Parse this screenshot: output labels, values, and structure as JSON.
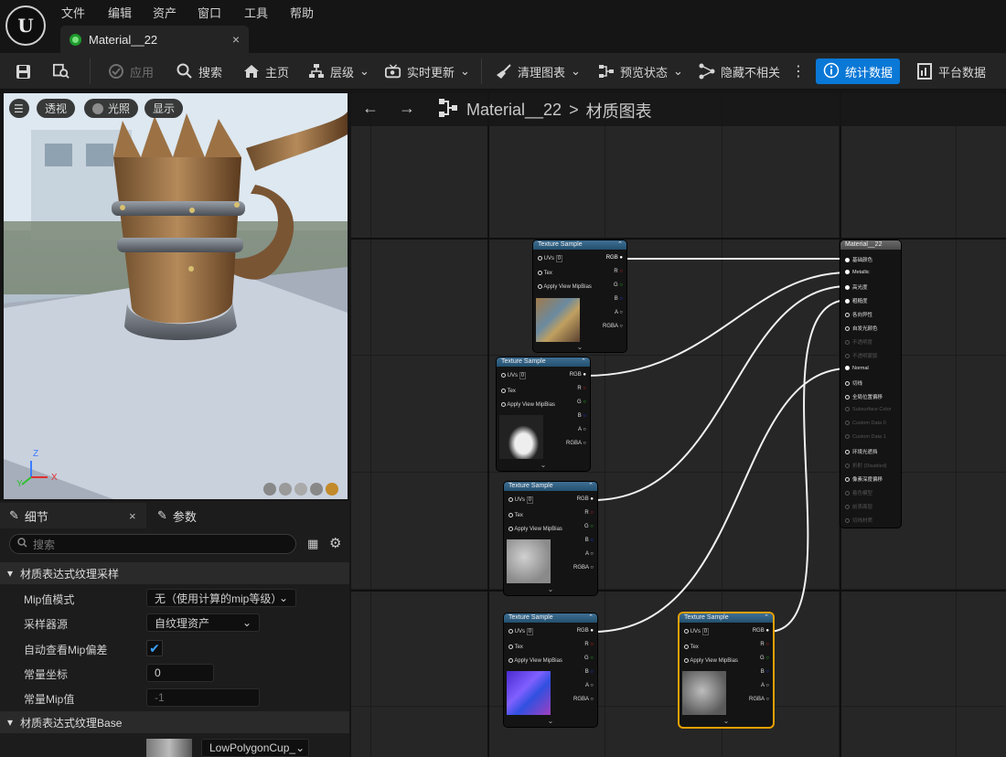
{
  "menu": [
    "文件",
    "编辑",
    "资产",
    "窗口",
    "工具",
    "帮助"
  ],
  "tab": {
    "title": "Material__22",
    "close": "×"
  },
  "toolbar": {
    "apply": "应用",
    "search": "搜索",
    "home": "主页",
    "hierarchy": "层级",
    "live_update": "实时更新",
    "clean_graph": "清理图表",
    "preview_state": "预览状态",
    "hide_unrelated": "隐藏不相关",
    "stats": "统计数据",
    "platform_stats": "平台数据",
    "more": "⋮"
  },
  "viewport": {
    "perspective": "透视",
    "lit": "光照",
    "show": "显示",
    "axis_x": "X",
    "axis_y": "Y",
    "axis_z": "Z"
  },
  "details": {
    "tab_details": "细节",
    "tab_params": "参数",
    "close": "×",
    "search_placeholder": "搜索",
    "section1": "材质表达式纹理采样",
    "rows": [
      {
        "label": "Mip值模式",
        "value": "无（使用计算的mip等级）"
      },
      {
        "label": "采样器源",
        "value": "自纹理资产"
      },
      {
        "label": "自动查看Mip偏差",
        "value": "✔"
      },
      {
        "label": "常量坐标",
        "value": "0"
      },
      {
        "label": "常量Mip值",
        "value": "-1"
      }
    ],
    "section2": "材质表达式纹理Base",
    "texture_value": "LowPolygonCup_"
  },
  "graph": {
    "crumb_root": "Material__22",
    "crumb_sep": ">",
    "crumb_leaf": "材质图表"
  },
  "texture_node": {
    "title": "Texture Sample",
    "inputs": [
      "UVs",
      "Tex",
      "Apply View MipBias"
    ],
    "uv_default": "0",
    "outputs": [
      "RGB",
      "R",
      "G",
      "B",
      "A",
      "RGBA"
    ],
    "expand": "⌄"
  },
  "material_node": {
    "title": "Material__22",
    "pins": [
      {
        "label": "基础颜色",
        "state": "on"
      },
      {
        "label": "Metallic",
        "state": "on"
      },
      {
        "label": "高光度",
        "state": "on"
      },
      {
        "label": "粗糙度",
        "state": "on"
      },
      {
        "label": "各向异性",
        "state": "off"
      },
      {
        "label": "自发光颜色",
        "state": "off"
      },
      {
        "label": "不透明度",
        "state": "dim"
      },
      {
        "label": "不透明蒙版",
        "state": "dim"
      },
      {
        "label": "Normal",
        "state": "on"
      },
      {
        "label": "切线",
        "state": "off"
      },
      {
        "label": "全局位置偏移",
        "state": "off"
      },
      {
        "label": "Subsurface Color",
        "state": "dim"
      },
      {
        "label": "Custom Data 0",
        "state": "dim"
      },
      {
        "label": "Custom Data 1",
        "state": "dim"
      },
      {
        "label": "环境光遮挡",
        "state": "off"
      },
      {
        "label": "折射 (Disabled)",
        "state": "dim"
      },
      {
        "label": "像素深度偏移",
        "state": "off"
      },
      {
        "label": "着色模型",
        "state": "dim"
      },
      {
        "label": "前表面层",
        "state": "dim"
      },
      {
        "label": "切线材质",
        "state": "dim"
      }
    ]
  },
  "colors": {
    "accent": "#0a78d6",
    "selected": "#e8a000",
    "node_header": "#2f5f82"
  }
}
